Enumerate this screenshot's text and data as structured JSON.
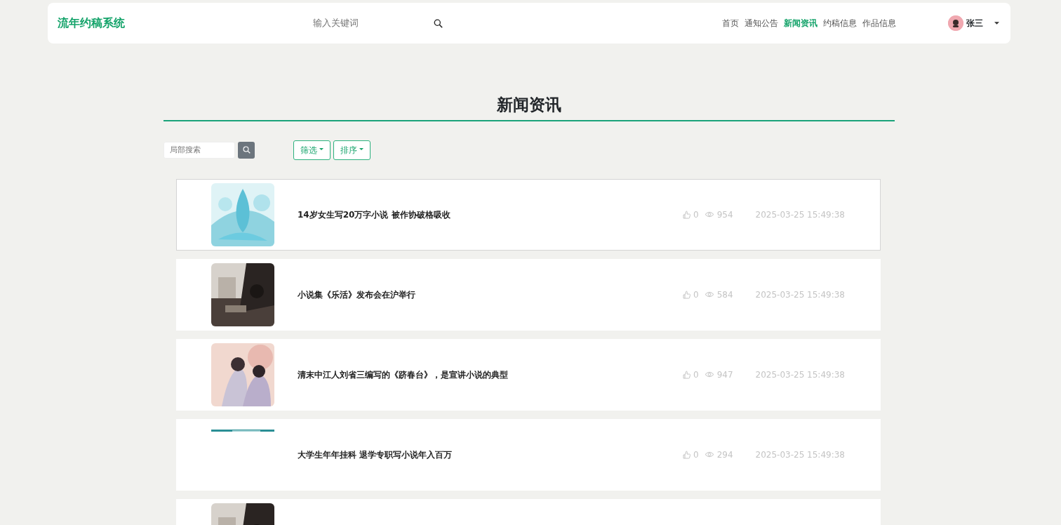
{
  "navbar": {
    "brand": "流年约稿系统",
    "search": {
      "placeholder": "输入关键词"
    },
    "links": [
      {
        "label": "首页",
        "selected": false
      },
      {
        "label": "通知公告",
        "selected": false
      },
      {
        "label": "新闻资讯",
        "selected": true
      },
      {
        "label": "约稿信息",
        "selected": false
      },
      {
        "label": "作品信息",
        "selected": false
      }
    ],
    "user": {
      "name": "张三"
    }
  },
  "heading": "新闻资讯",
  "toolbar": {
    "search": {
      "placeholder": "局部搜索"
    },
    "dropdowns": [
      "筛选",
      "排序"
    ]
  },
  "news": [
    {
      "kind": "picture",
      "hovered": true,
      "title": "14岁女生写20万字小说 被作协破格吸收",
      "likes": "0",
      "views": "954",
      "date": "2025-03-25 15:49:38"
    },
    {
      "kind": "picture",
      "hovered": false,
      "title": "小说集《乐活》发布会在沪举行",
      "likes": "0",
      "views": "584",
      "date": "2025-03-25 15:49:38"
    },
    {
      "kind": "picture",
      "hovered": false,
      "title": "清末中江人刘省三编写的《跻春台》，是宣讲小说的典型",
      "likes": "0",
      "views": "947",
      "date": "2025-03-25 15:49:38"
    },
    {
      "kind": "unloaded",
      "hovered": false,
      "title": "大学生年年挂科 退学专职写小说年入百万",
      "likes": "0",
      "views": "294",
      "date": "2025-03-25 15:49:38"
    },
    {
      "kind": "picture",
      "hovered": false
    }
  ]
}
